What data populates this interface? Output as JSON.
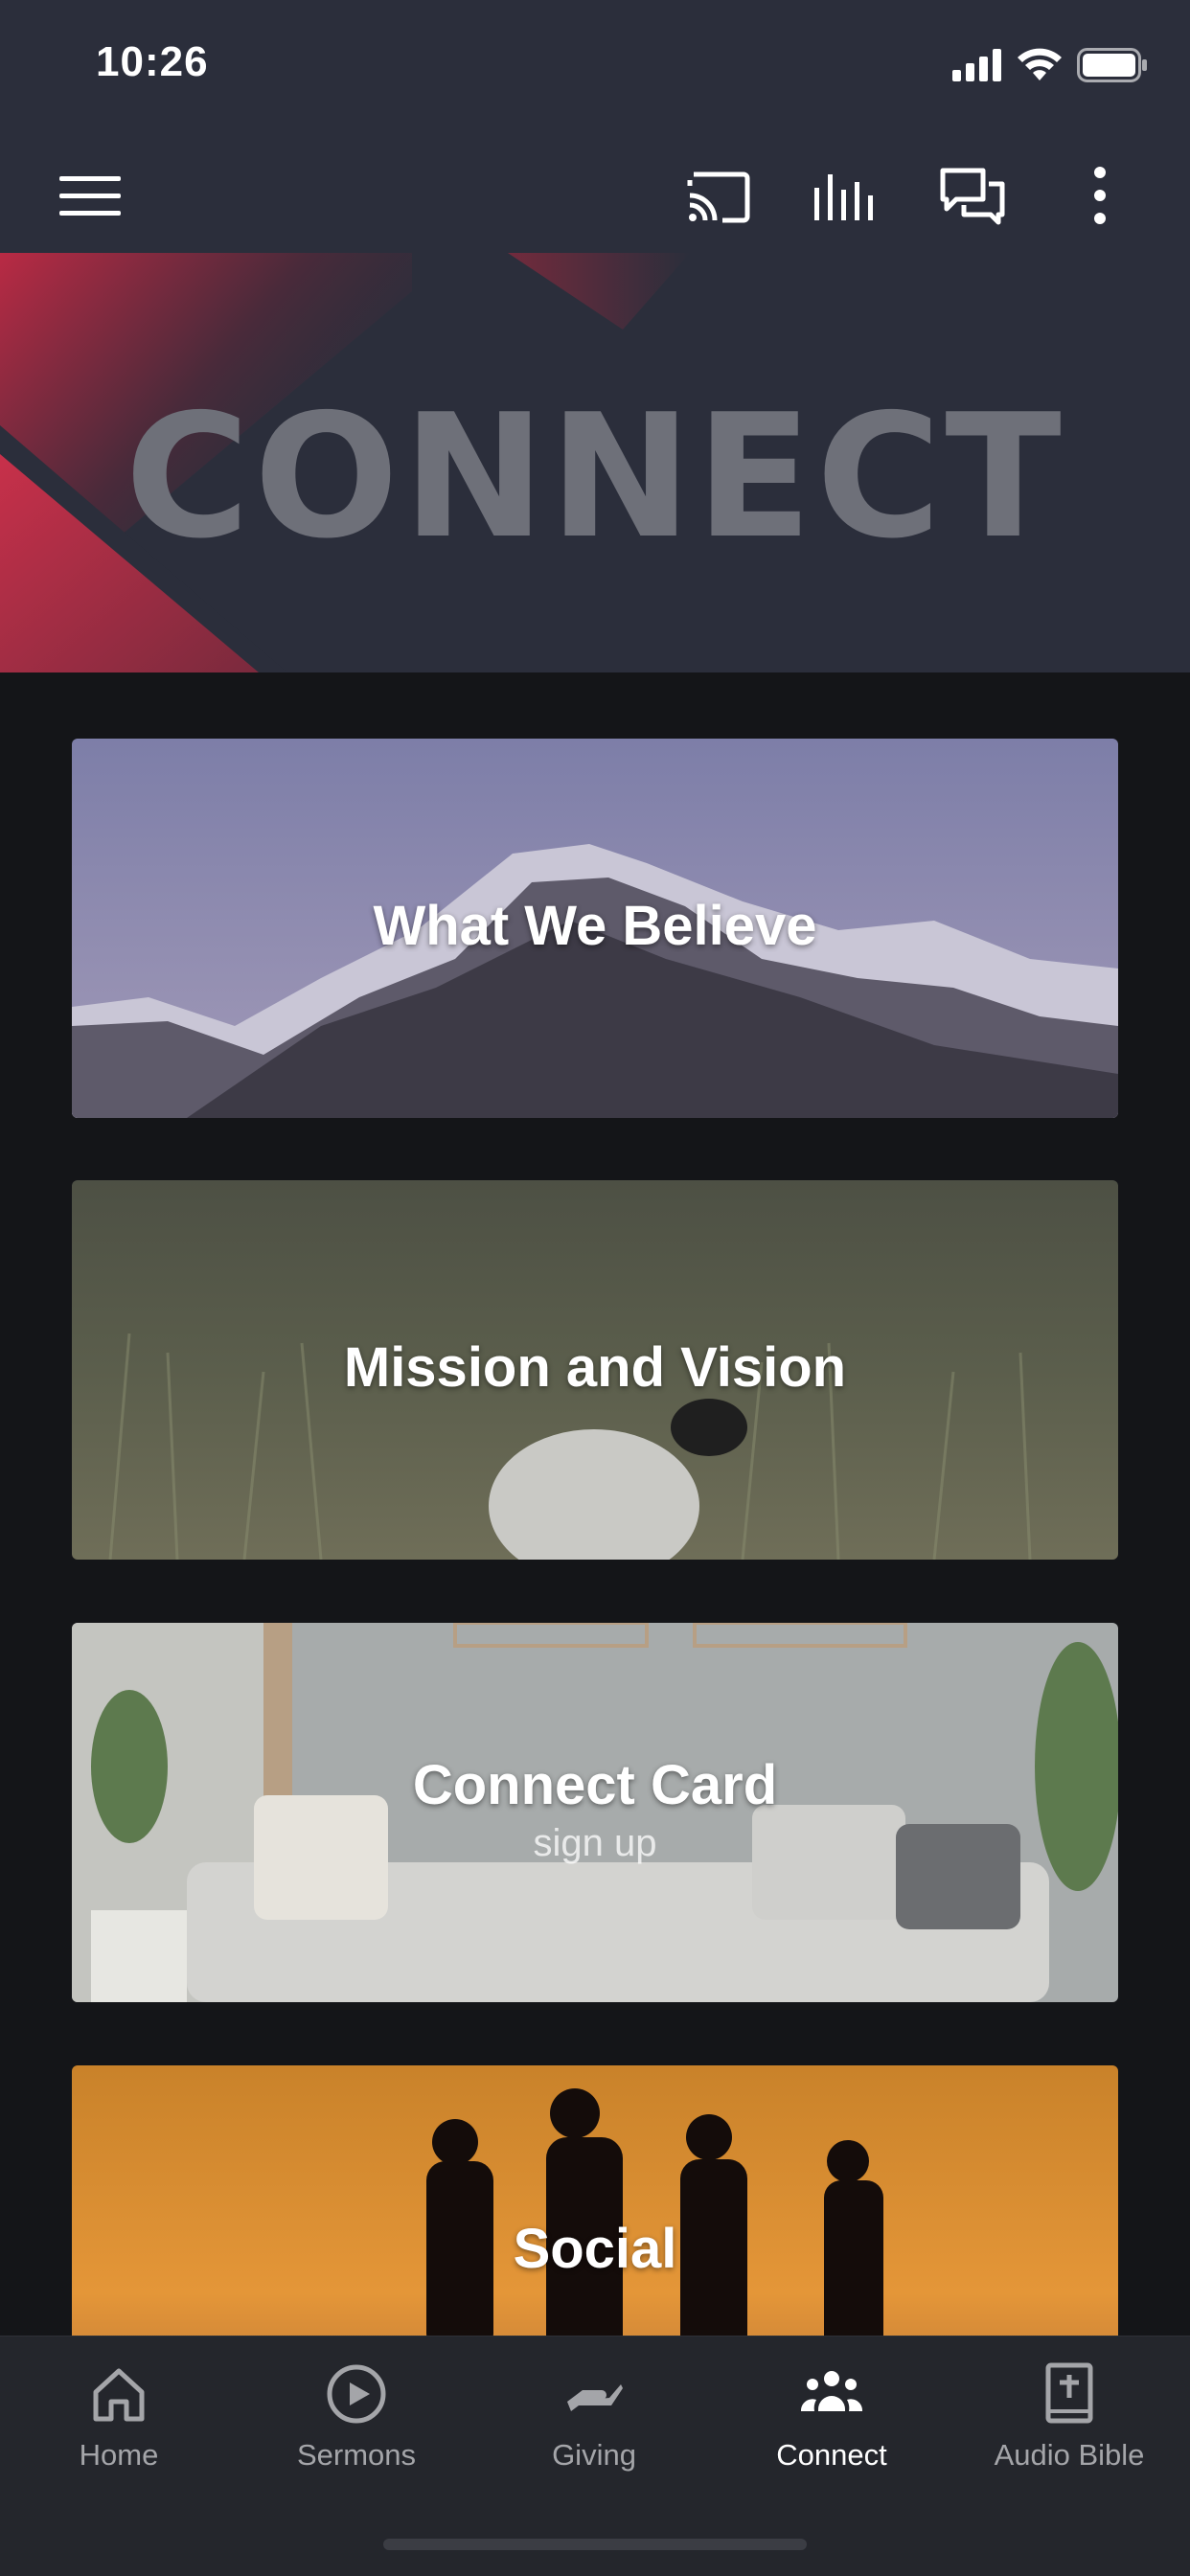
{
  "status_bar": {
    "time": "10:26"
  },
  "toolbar": {
    "menu_icon": "hamburger-icon",
    "cast_icon": "cast-icon",
    "audio_icon": "audio-bars-icon",
    "chat_icon": "chat-bubbles-icon",
    "more_icon": "more-vertical-icon"
  },
  "hero": {
    "title": "CONNECT"
  },
  "cards": [
    {
      "title": "What We Believe",
      "subtitle": ""
    },
    {
      "title": "Mission and Vision",
      "subtitle": ""
    },
    {
      "title": "Connect Card",
      "subtitle": "sign up"
    },
    {
      "title": "Social",
      "subtitle": ""
    }
  ],
  "bottom_nav": {
    "items": [
      {
        "label": "Home",
        "icon": "home-icon",
        "active": false
      },
      {
        "label": "Sermons",
        "icon": "play-circle-icon",
        "active": false
      },
      {
        "label": "Giving",
        "icon": "hand-giving-icon",
        "active": false
      },
      {
        "label": "Connect",
        "icon": "group-icon",
        "active": true
      },
      {
        "label": "Audio Bible",
        "icon": "bible-icon",
        "active": false
      }
    ]
  },
  "colors": {
    "topbar": "#2b2e3b",
    "accent_red": "#c8304a",
    "background": "#141518",
    "nav_background": "#24262c"
  }
}
